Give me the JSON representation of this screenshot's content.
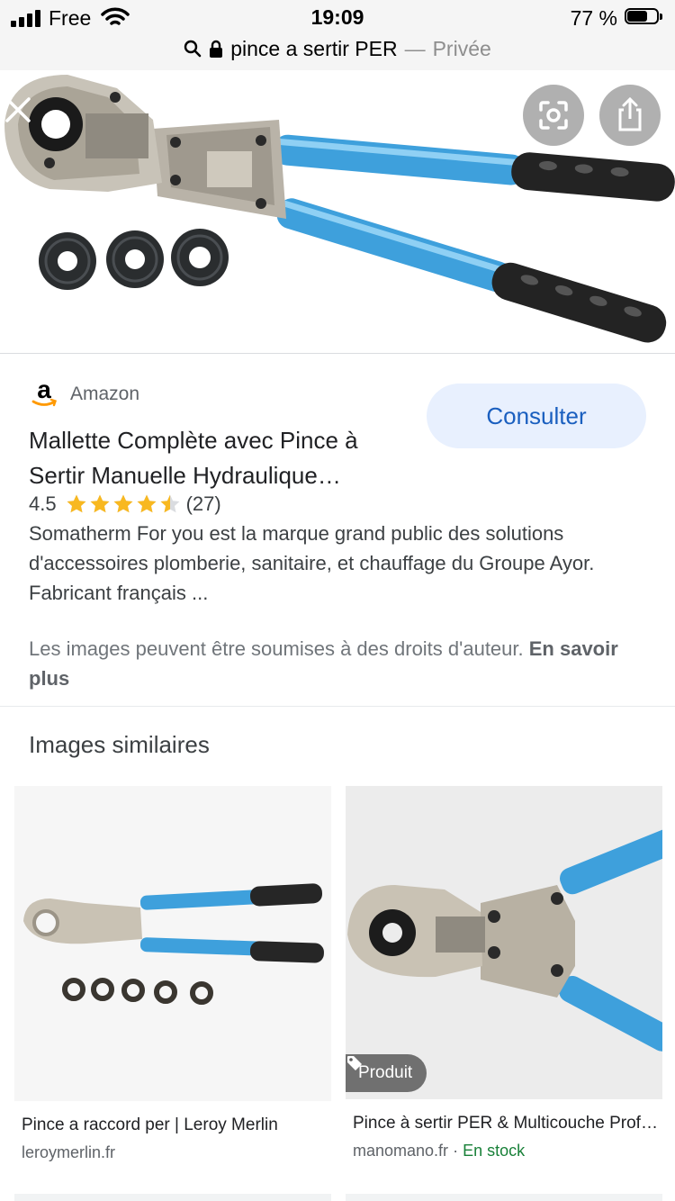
{
  "status_bar": {
    "carrier": "Free",
    "time": "19:09",
    "battery": "77 %",
    "battery_level": 0.77,
    "icons": [
      "signal-icon",
      "wifi-icon",
      "battery-icon"
    ]
  },
  "url_bar": {
    "query": "pince a sertir PER",
    "separator": "—",
    "mode": "Privée",
    "icons": [
      "search-icon",
      "lock-icon"
    ]
  },
  "hero": {
    "icons": [
      "close-icon",
      "lens-icon",
      "share-icon"
    ]
  },
  "result": {
    "source": "Amazon",
    "title": "Mallette Complète avec Pince à Sertir Manuelle Hydraulique…",
    "rating": "4.5",
    "rating_value": 4.5,
    "rating_max": 5,
    "reviews": "(27)",
    "description": "Somatherm For you est la marque grand public des solutions d'accessoires plomberie, sanitaire, et chauffage du Groupe Ayor. Fabricant français ...",
    "consult_label": "Consulter",
    "rights_text": "Les images peuvent être soumises à des droits d'auteur.",
    "learn_more": "En savoir plus"
  },
  "similar": {
    "heading": "Images similaires",
    "items": [
      {
        "title": "Pince a raccord per | Leroy Merlin",
        "domain": "leroymerlin.fr"
      },
      {
        "title": "Pince à sertir PER & Multicouche Professionnelle",
        "domain": "manomano.fr",
        "separator": "·",
        "stock": "En stock",
        "badge": "Produit"
      }
    ]
  },
  "colors": {
    "accent": "#1a5fbf",
    "button_bg": "#e8f0fe",
    "star": "#f8b820",
    "stock_green": "#188038",
    "tool_blue": "#3ea0dc"
  }
}
